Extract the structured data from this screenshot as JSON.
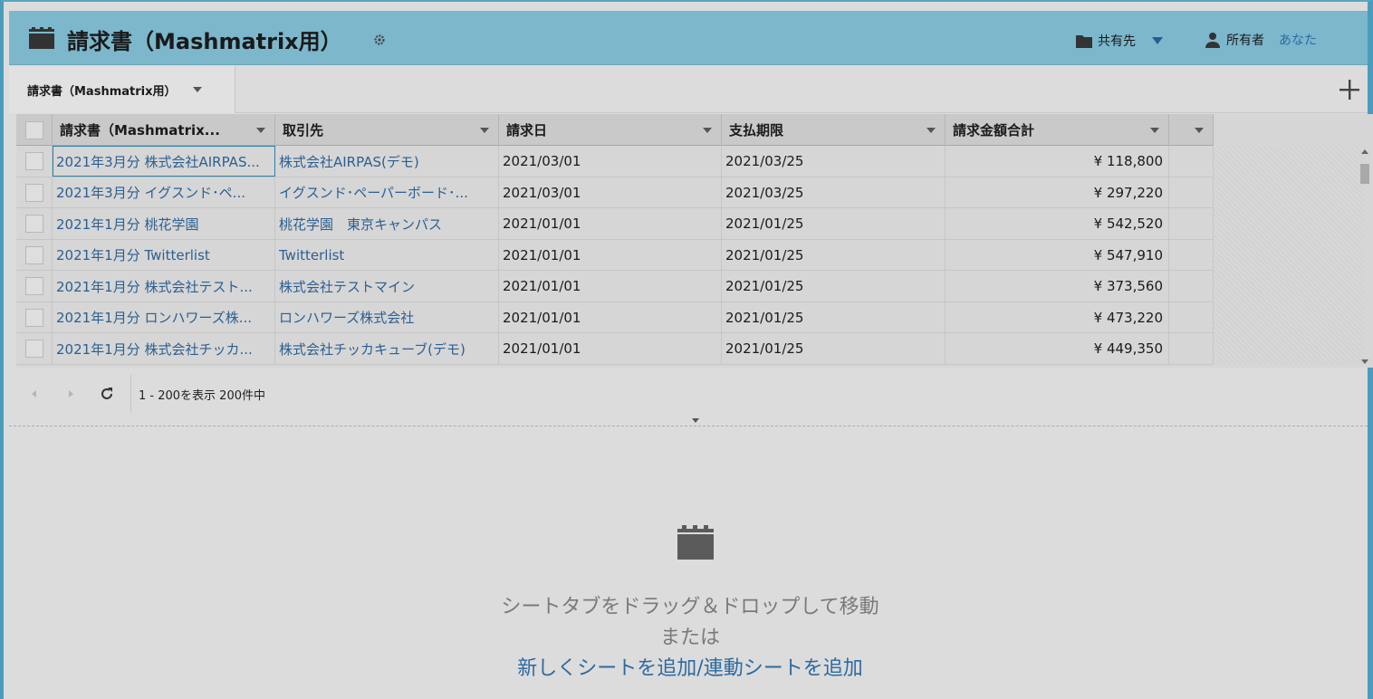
{
  "header": {
    "title": "請求書（Mashmatrix用）",
    "share_label": "共有先",
    "owner_label": "所有者",
    "owner_value": "あなた"
  },
  "tabs": [
    {
      "label": "請求書（Mashmatrix用）"
    }
  ],
  "grid": {
    "columns": [
      "請求書（Mashmatrix...",
      "取引先",
      "請求日",
      "支払期限",
      "請求金額合計"
    ],
    "rows": [
      {
        "name": "2021年3月分 株式会社AIRPAS...",
        "account": "株式会社AIRPAS(デモ)",
        "invoice_date": "2021/03/01",
        "due_date": "2021/03/25",
        "amount": "¥ 118,800"
      },
      {
        "name": "2021年3月分 イグスンド･ペ...",
        "account": "イグスンド･ペーパーボード･...",
        "invoice_date": "2021/03/01",
        "due_date": "2021/03/25",
        "amount": "¥ 297,220"
      },
      {
        "name": "2021年1月分 桃花学園",
        "account": "桃花学園　東京キャンパス",
        "invoice_date": "2021/01/01",
        "due_date": "2021/01/25",
        "amount": "¥ 542,520"
      },
      {
        "name": "2021年1月分 Twitterlist",
        "account": "Twitterlist",
        "invoice_date": "2021/01/01",
        "due_date": "2021/01/25",
        "amount": "¥ 547,910"
      },
      {
        "name": "2021年1月分 株式会社テスト...",
        "account": "株式会社テストマイン",
        "invoice_date": "2021/01/01",
        "due_date": "2021/01/25",
        "amount": "¥ 373,560"
      },
      {
        "name": "2021年1月分 ロンハワーズ株...",
        "account": "ロンハワーズ株式会社",
        "invoice_date": "2021/01/01",
        "due_date": "2021/01/25",
        "amount": "¥ 473,220"
      },
      {
        "name": "2021年1月分 株式会社チッカ...",
        "account": "株式会社チッカキューブ(デモ)",
        "invoice_date": "2021/01/01",
        "due_date": "2021/01/25",
        "amount": "¥ 449,350"
      }
    ]
  },
  "pager": {
    "status": "1 - 200を表示 200件中"
  },
  "empty_panel": {
    "line1": "シートタブをドラッグ＆ドロップして移動",
    "line2": "または",
    "line3": "新しくシートを追加/連動シートを追加"
  },
  "colors": {
    "header_bg": "#7cb7cc",
    "link": "#2c5f91",
    "accent": "#2d6aa0"
  }
}
